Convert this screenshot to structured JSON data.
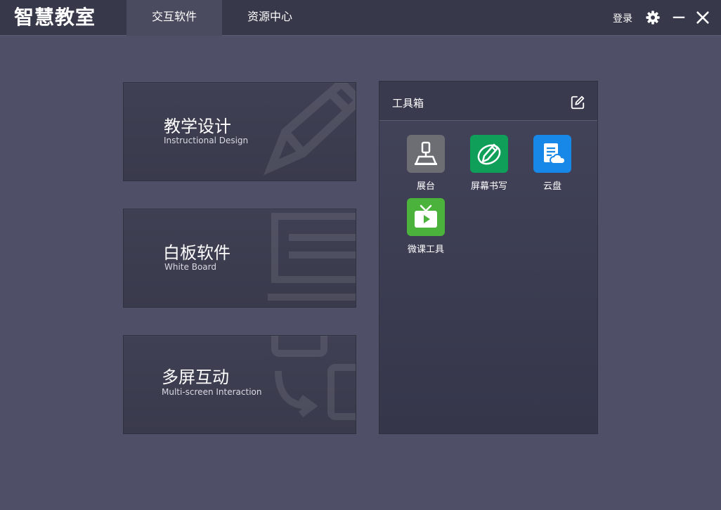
{
  "app": {
    "title": "智慧教室"
  },
  "tabs": [
    {
      "label": "交互软件",
      "active": true
    },
    {
      "label": "资源中心",
      "active": false
    }
  ],
  "header": {
    "login_label": "登录",
    "icons": [
      "gear-icon",
      "minimize-icon",
      "close-icon"
    ]
  },
  "cards": [
    {
      "title": "教学设计",
      "subtitle": "Instructional Design",
      "bg_icon": "pencil-icon"
    },
    {
      "title": "白板软件",
      "subtitle": "White Board",
      "bg_icon": "whiteboard-icon"
    },
    {
      "title": "多屏互动",
      "subtitle": "Multi-screen Interaction",
      "bg_icon": "multiscreen-icon"
    }
  ],
  "toolbox": {
    "title": "工具箱",
    "edit_icon": "edit-icon",
    "tools": [
      {
        "label": "展台",
        "icon": "document-camera-icon",
        "color": "#6d6e73"
      },
      {
        "label": "屏幕书写",
        "icon": "pen-writing-icon",
        "color": "#0f9f59"
      },
      {
        "label": "云盘",
        "icon": "cloud-drive-icon",
        "color": "#1787e8"
      },
      {
        "label": "微课工具",
        "icon": "tv-play-icon",
        "color": "#4bb33b"
      }
    ]
  },
  "colors": {
    "background": "#4f5068",
    "titlebar": "#373849",
    "active_tab": "#4a4b5f",
    "card": "#3d3e51"
  }
}
